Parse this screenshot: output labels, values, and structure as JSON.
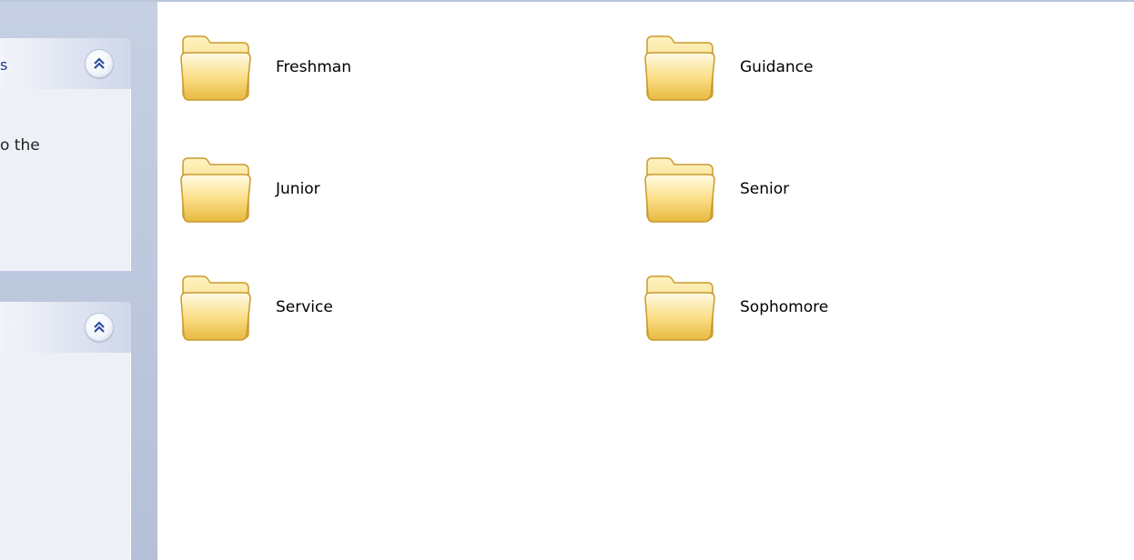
{
  "task_pane": {
    "panels": [
      {
        "title": "s",
        "body_text": "o the",
        "collapse_icon": "chevron-up-double-icon"
      },
      {
        "title": "",
        "body_text": "",
        "collapse_icon": "chevron-up-double-icon"
      }
    ]
  },
  "folders": [
    {
      "name": "Freshman",
      "icon": "folder-icon"
    },
    {
      "name": "Guidance",
      "icon": "folder-icon"
    },
    {
      "name": "Junior",
      "icon": "folder-icon"
    },
    {
      "name": "Senior",
      "icon": "folder-icon"
    },
    {
      "name": "Service",
      "icon": "folder-icon"
    },
    {
      "name": "Sophomore",
      "icon": "folder-icon"
    }
  ],
  "colors": {
    "task_pane_bg": "#c6d0e3",
    "panel_body_bg": "#edf0f6",
    "folder_yellow": "#f7d774",
    "content_bg": "#ffffff"
  }
}
